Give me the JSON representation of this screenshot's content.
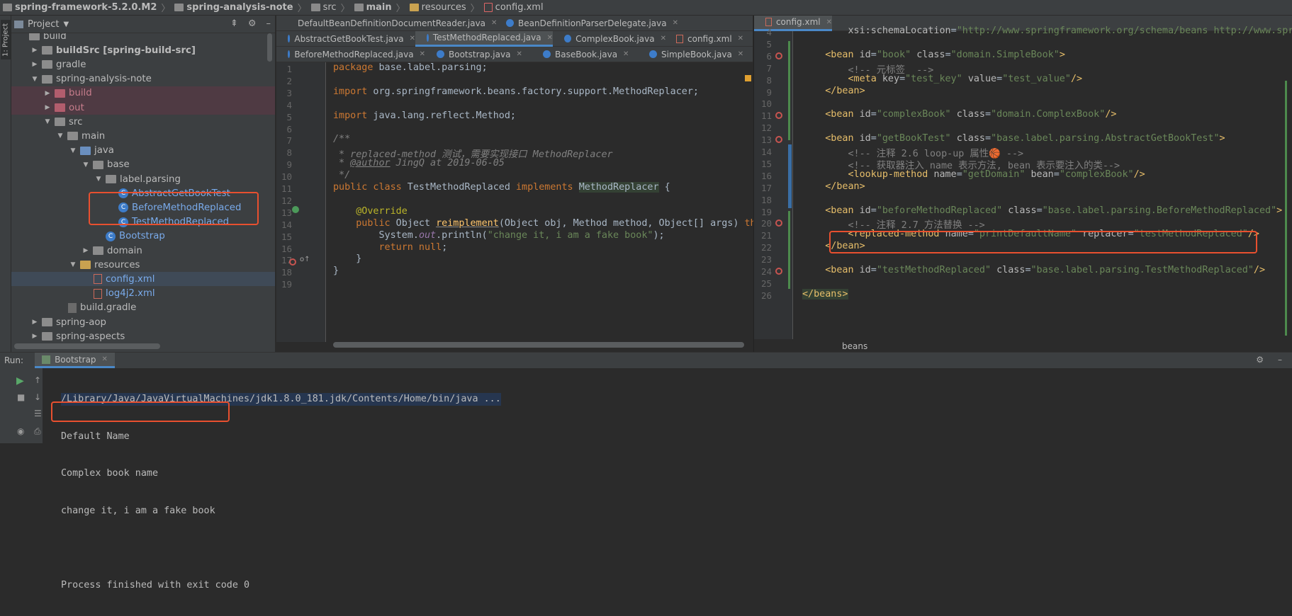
{
  "breadcrumb": [
    "spring-framework-5.2.0.M2",
    "spring-analysis-note",
    "src",
    "main",
    "resources",
    "config.xml"
  ],
  "sidebar": {
    "stripe_label": "1: Project"
  },
  "project": {
    "title": "Project",
    "items": [
      {
        "label": "build",
        "indent": 0,
        "kind": "folder-partial"
      },
      {
        "label": "buildSrc [spring-build-src]",
        "indent": 1,
        "kind": "folder",
        "arrow": "▶"
      },
      {
        "label": "gradle",
        "indent": 1,
        "kind": "folder",
        "arrow": "▶"
      },
      {
        "label": "spring-analysis-note",
        "indent": 1,
        "kind": "folder",
        "arrow": "▼"
      },
      {
        "label": "build",
        "indent": 2,
        "kind": "folder-red",
        "arrow": "▶",
        "row": "red"
      },
      {
        "label": "out",
        "indent": 2,
        "kind": "folder-red",
        "arrow": "▶",
        "row": "red"
      },
      {
        "label": "src",
        "indent": 2,
        "kind": "folder",
        "arrow": "▼"
      },
      {
        "label": "main",
        "indent": 3,
        "kind": "folder",
        "arrow": "▼"
      },
      {
        "label": "java",
        "indent": 4,
        "kind": "folder-blue",
        "arrow": "▼"
      },
      {
        "label": "base",
        "indent": 5,
        "kind": "folder",
        "arrow": "▼"
      },
      {
        "label": "label.parsing",
        "indent": 6,
        "kind": "folder",
        "arrow": "▼"
      },
      {
        "label": "AbstractGetBookTest",
        "indent": 7,
        "kind": "class"
      },
      {
        "label": "BeforeMethodReplaced",
        "indent": 7,
        "kind": "class"
      },
      {
        "label": "TestMethodReplaced",
        "indent": 7,
        "kind": "class"
      },
      {
        "label": "Bootstrap",
        "indent": 6,
        "kind": "class"
      },
      {
        "label": "domain",
        "indent": 5,
        "kind": "folder",
        "arrow": "▶"
      },
      {
        "label": "resources",
        "indent": 4,
        "kind": "folder-yellow",
        "arrow": "▼"
      },
      {
        "label": "config.xml",
        "indent": 5,
        "kind": "xml",
        "row": "sel"
      },
      {
        "label": "log4j2.xml",
        "indent": 5,
        "kind": "xml"
      },
      {
        "label": "build.gradle",
        "indent": 3,
        "kind": "gradle"
      },
      {
        "label": "spring-aop",
        "indent": 1,
        "kind": "folder",
        "arrow": "▶"
      },
      {
        "label": "spring-aspects",
        "indent": 1,
        "kind": "folder",
        "arrow": "▶"
      }
    ]
  },
  "editor1": {
    "tabs_row1": [
      "DefaultBeanDefinitionDocumentReader.java",
      "BeanDefinitionParserDelegate.java"
    ],
    "tabs_row2": [
      "AbstractGetBookTest.java",
      "TestMethodReplaced.java",
      "ComplexBook.java",
      "config.xml"
    ],
    "tabs_row3": [
      "BeforeMethodReplaced.java",
      "Bootstrap.java",
      "BaseBook.java",
      "SimpleBook.java"
    ],
    "line_numbers": [
      "1",
      "2",
      "3",
      "4",
      "5",
      "6",
      "7",
      "8",
      "9",
      "10",
      "11",
      "12",
      "13",
      "14",
      "15",
      "16",
      "17",
      "18",
      "19"
    ]
  },
  "editor2": {
    "tab": "config.xml",
    "line_numbers": [
      "4",
      "5",
      "6",
      "7",
      "8",
      "9",
      "10",
      "11",
      "12",
      "13",
      "14",
      "15",
      "16",
      "17",
      "18",
      "19",
      "20",
      "21",
      "22",
      "23",
      "24",
      "25",
      "26"
    ],
    "status": "beans"
  },
  "run": {
    "label": "Run:",
    "tab": "Bootstrap",
    "console": [
      "/Library/Java/JavaVirtualMachines/jdk1.8.0_181.jdk/Contents/Home/bin/java ...",
      "Default Name",
      "Complex book name",
      "change it, i am a fake book",
      "",
      "Process finished with exit code 0"
    ]
  }
}
